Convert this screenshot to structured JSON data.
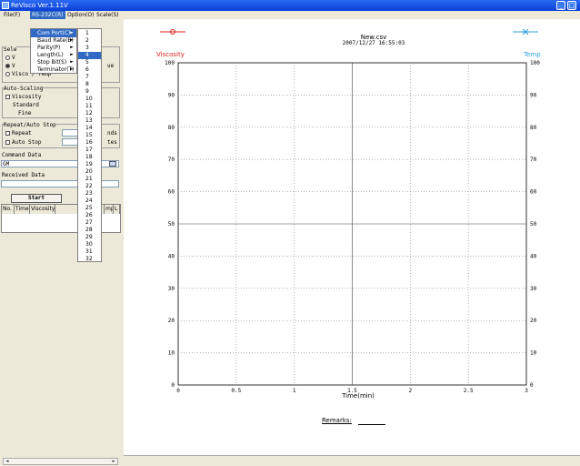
{
  "window": {
    "title": "ReVisco Ver.1.11V",
    "title_color": "#0a3fd6",
    "minimize_label": "_",
    "maximize_label": "□"
  },
  "menubar": {
    "items": [
      "File(F)",
      "RS-232C(R)",
      "Option(O)",
      "Scale(S)"
    ]
  },
  "left_panel": {
    "select_group_title": "Sele",
    "select_options": [
      "Visco",
      "Visco / Temp",
      "Visco / Temp"
    ],
    "select_option_1_label": "V",
    "select_option_2_label": "V",
    "select_option_3_label": "Visco / Temp",
    "select_side_label": "ue",
    "auto_scaling_title": "Auto-Scaling",
    "viscosity_check_label": "Viscosity",
    "standard_label": "Standard",
    "fine_label": "Fine",
    "repeat_title": "Repeat/Auto Stop",
    "repeat_label": "Repeat",
    "auto_stop_label": "Auto Stop",
    "repeat_unit": "nds",
    "auto_stop_unit": "tes",
    "command_data_title": "Command Data",
    "command_value": "GM",
    "received_data_title": "Received Data",
    "received_value": "",
    "start_button": "Start",
    "table_headers": [
      "No.",
      "Time",
      "Viscosity",
      "",
      "mp",
      "L"
    ],
    "scroll_left": "◄",
    "scroll_right": "►"
  },
  "dropdown_menu": {
    "items": [
      {
        "label": "Com Port(C)",
        "arrow": "►"
      },
      {
        "label": "Baud Rate(B)",
        "arrow": "►"
      },
      {
        "label": "Parity(P)",
        "arrow": "►"
      },
      {
        "label": "Length(L)",
        "arrow": "►"
      },
      {
        "label": "Stop Bit(S)",
        "arrow": "►"
      },
      {
        "label": "Terminator(T)",
        "arrow": "►"
      }
    ],
    "selected_index": 0
  },
  "port_submenu": {
    "items": [
      "1",
      "2",
      "3",
      "4",
      "5",
      "6",
      "7",
      "8",
      "9",
      "10",
      "11",
      "12",
      "13",
      "14",
      "15",
      "16",
      "17",
      "18",
      "19",
      "20",
      "21",
      "22",
      "23",
      "24",
      "25",
      "26",
      "27",
      "28",
      "29",
      "30",
      "31",
      "32"
    ],
    "selected_index": 3,
    "checked_item": "4"
  },
  "plot": {
    "file_name": "New.csv",
    "datetime": "2007/12/27 16:55:03",
    "left_legend": "Viscosity",
    "right_legend": "Temp",
    "left_color": "#e0201a",
    "right_color": "#2aa0d8",
    "remarks_label": "Remarks:"
  },
  "chart_data": {
    "type": "line",
    "title": "New.csv",
    "subtitle": "2007/12/27 16:55:03",
    "xlabel": "Time(min)",
    "ylabel": "Viscosity",
    "y2label": "Temp",
    "xlim": [
      0,
      3
    ],
    "ylim": [
      0,
      100
    ],
    "y2lim": [
      0,
      100
    ],
    "x_ticks": [
      "0",
      "0.5",
      "1",
      "1.5",
      "2",
      "2.5",
      "3"
    ],
    "y_ticks": [
      "0",
      "10",
      "20",
      "30",
      "40",
      "50",
      "60",
      "70",
      "80",
      "90",
      "100"
    ],
    "grid": true,
    "series": [
      {
        "name": "Viscosity",
        "values": []
      },
      {
        "name": "Temp",
        "values": []
      }
    ]
  }
}
